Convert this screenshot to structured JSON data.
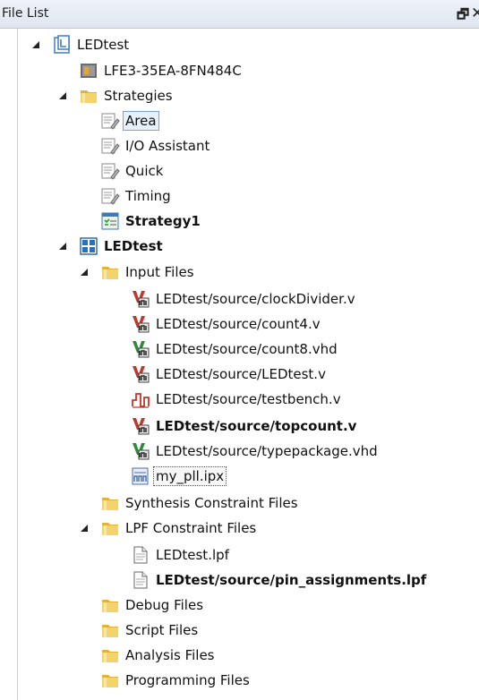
{
  "panel": {
    "title": "File List",
    "float_glyph": "🗗",
    "close_glyph": "✕"
  },
  "tree": [
    {
      "label": "LEDtest",
      "icon": "project-icon",
      "expanded": true
    },
    {
      "label": "LFE3-35EA-8FN484C",
      "icon": "chip-icon"
    },
    {
      "label": "Strategies",
      "icon": "folder-icon",
      "expanded": true
    },
    {
      "label": "Area",
      "icon": "strategy-icon",
      "selected": true
    },
    {
      "label": "I/O Assistant",
      "icon": "strategy-icon"
    },
    {
      "label": "Quick",
      "icon": "strategy-icon"
    },
    {
      "label": "Timing",
      "icon": "strategy-icon"
    },
    {
      "label": "Strategy1",
      "icon": "active-strategy-icon",
      "bold": true
    },
    {
      "label": "LEDtest",
      "icon": "implementation-icon",
      "bold": true,
      "expanded": true
    },
    {
      "label": "Input Files",
      "icon": "folder-icon",
      "expanded": true
    },
    {
      "label": "LEDtest/source/clockDivider.v",
      "icon": "verilog-file-icon"
    },
    {
      "label": "LEDtest/source/count4.v",
      "icon": "verilog-file-icon"
    },
    {
      "label": "LEDtest/source/count8.vhd",
      "icon": "vhdl-file-icon"
    },
    {
      "label": "LEDtest/source/LEDtest.v",
      "icon": "verilog-file-icon"
    },
    {
      "label": "LEDtest/source/testbench.v",
      "icon": "simulation-file-icon"
    },
    {
      "label": "LEDtest/source/topcount.v",
      "icon": "verilog-file-icon",
      "bold": true
    },
    {
      "label": "LEDtest/source/typepackage.vhd",
      "icon": "vhdl-file-icon"
    },
    {
      "label": "my_pll.ipx",
      "icon": "ipx-file-icon",
      "focused": true
    },
    {
      "label": "Synthesis Constraint Files",
      "icon": "folder-icon"
    },
    {
      "label": "LPF Constraint Files",
      "icon": "folder-icon",
      "expanded": true
    },
    {
      "label": "LEDtest.lpf",
      "icon": "document-icon"
    },
    {
      "label": "LEDtest/source/pin_assignments.lpf",
      "icon": "document-icon",
      "bold": true
    },
    {
      "label": "Debug Files",
      "icon": "folder-icon"
    },
    {
      "label": "Script Files",
      "icon": "folder-icon"
    },
    {
      "label": "Analysis Files",
      "icon": "folder-icon"
    },
    {
      "label": "Programming Files",
      "icon": "folder-icon"
    }
  ]
}
